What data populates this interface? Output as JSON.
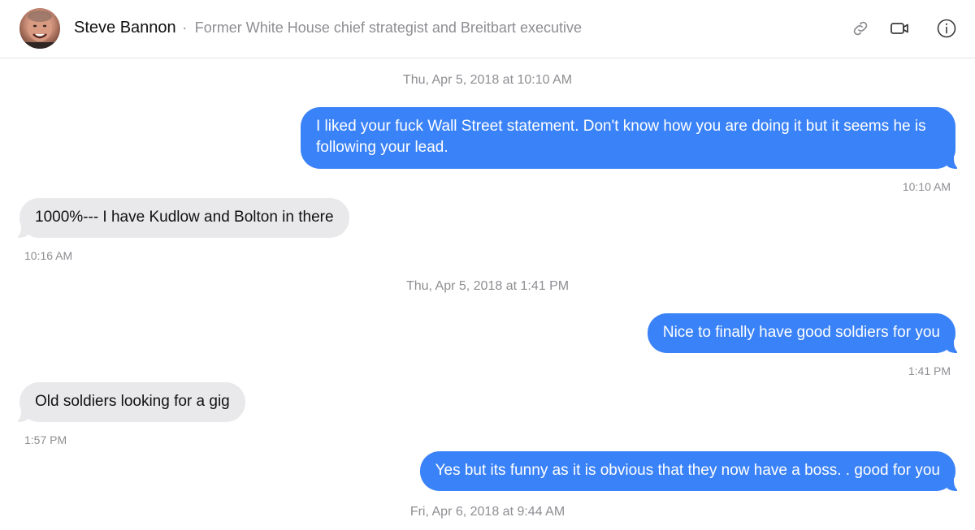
{
  "header": {
    "contact_name": "Steve Bannon",
    "separator": "·",
    "contact_description": "Former White House chief strategist and Breitbart executive",
    "icons": [
      "link-icon",
      "video-camera-icon",
      "info-icon"
    ]
  },
  "messages": [
    {
      "type": "date",
      "text": "Thu, Apr 5, 2018 at 10:10 AM"
    },
    {
      "type": "outgoing",
      "text": "I liked your fuck Wall Street statement. Don't know how you are doing it but it seems he is following your lead.",
      "time": "10:10 AM"
    },
    {
      "type": "incoming",
      "text": "1000%--- I have Kudlow and Bolton in there",
      "time": "10:16 AM"
    },
    {
      "type": "date",
      "text": "Thu, Apr 5, 2018 at 1:41 PM"
    },
    {
      "type": "outgoing",
      "text": "Nice to finally have good soldiers for you",
      "time": "1:41 PM"
    },
    {
      "type": "incoming",
      "text": "Old soldiers looking for a gig",
      "time": "1:57 PM"
    },
    {
      "type": "outgoing",
      "text": "Yes but its funny as it is obvious that they now have a boss. . good for you"
    },
    {
      "type": "date",
      "text": "Fri, Apr 6, 2018 at 9:44 AM"
    }
  ],
  "colors": {
    "outgoing_bubble": "#3a82f7",
    "incoming_bubble": "#e9e9eb",
    "secondary_text": "#8e8e93"
  }
}
